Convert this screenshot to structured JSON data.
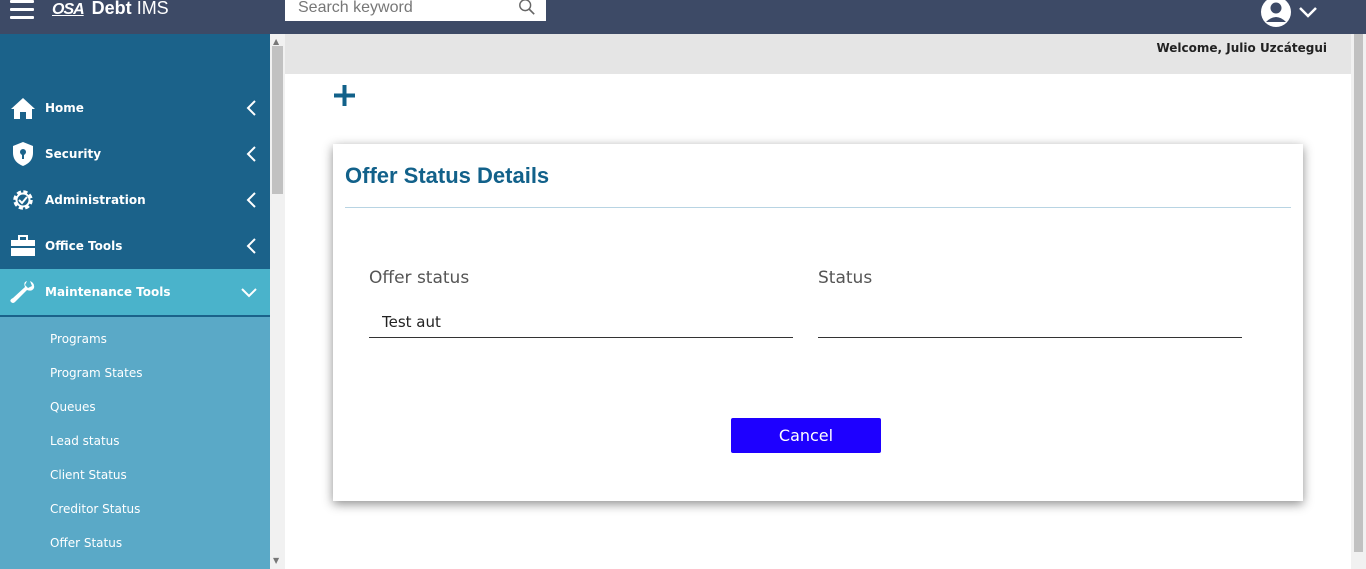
{
  "header": {
    "logo_mark": "OSA",
    "app_name": "Debt",
    "app_suffix": "IMS",
    "search_placeholder": "Search keyword"
  },
  "welcome": "Welcome, Julio Uzcátegui",
  "sidebar": {
    "items": [
      {
        "label": "Home",
        "icon": "home-icon"
      },
      {
        "label": "Security",
        "icon": "shield-icon"
      },
      {
        "label": "Administration",
        "icon": "gear-icon"
      },
      {
        "label": "Office Tools",
        "icon": "briefcase-icon"
      },
      {
        "label": "Maintenance Tools",
        "icon": "wrench-icon"
      }
    ],
    "submenu": [
      "Programs",
      "Program States",
      "Queues",
      "Lead status",
      "Client Status",
      "Creditor Status",
      "Offer Status"
    ]
  },
  "card": {
    "title": "Offer Status Details",
    "fields": [
      {
        "label": "Offer status",
        "value": "Test aut"
      },
      {
        "label": "Status",
        "value": ""
      }
    ],
    "cancel_label": "Cancel"
  },
  "colors": {
    "topbar": "#3d4a66",
    "sidebar": "#1b628a",
    "sidebar_active": "#4ab3cb",
    "submenu": "#5aa9c7",
    "title": "#12618a",
    "cancel": "#1e00ff"
  }
}
